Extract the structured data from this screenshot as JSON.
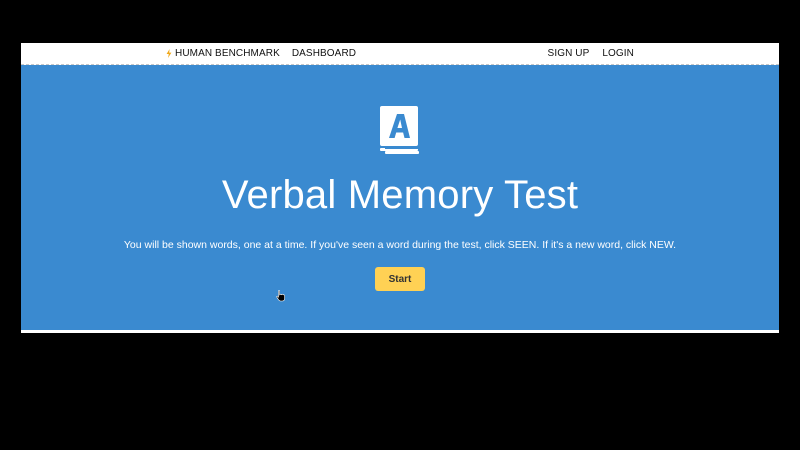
{
  "navbar": {
    "brand_label": "HUMAN BENCHMARK",
    "dashboard_label": "DASHBOARD",
    "signup_label": "SIGN UP",
    "login_label": "LOGIN",
    "brand_icon": "lightning-bolt-icon"
  },
  "hero": {
    "icon": "book-letter-a-icon",
    "title": "Verbal Memory Test",
    "description": "You will be shown words, one at a time. If you've seen a word during the test, click SEEN. If it's a new word, click NEW.",
    "start_label": "Start"
  },
  "colors": {
    "hero_background": "#3a8ad0",
    "start_button": "#ffd154",
    "navbar_background": "#ffffff",
    "page_background": "#000000"
  }
}
